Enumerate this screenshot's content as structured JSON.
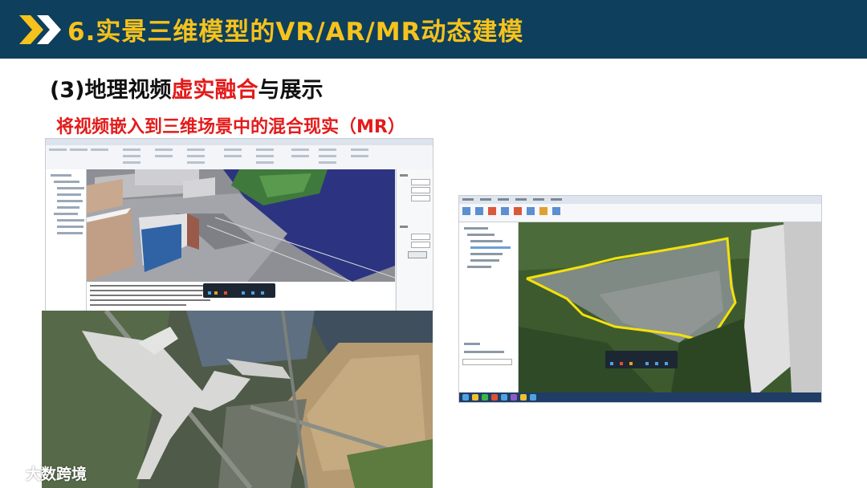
{
  "header": {
    "title": "6.实景三维模型的VR/AR/MR动态建模",
    "bg_color": "#0e3f5c",
    "title_color": "#f6c21c",
    "icon": "double-chevron-right-icon"
  },
  "subtitle": {
    "prefix": "(3)地理视频",
    "highlight": "虚实融合",
    "suffix": "与展示",
    "highlight_color": "#e31b1b"
  },
  "caption": {
    "text": "将视频嵌入到三维场景中的混合现实（MR）",
    "color": "#e31b1b"
  },
  "watermark": {
    "text": "大数跨境",
    "icon": "logo-icon"
  }
}
